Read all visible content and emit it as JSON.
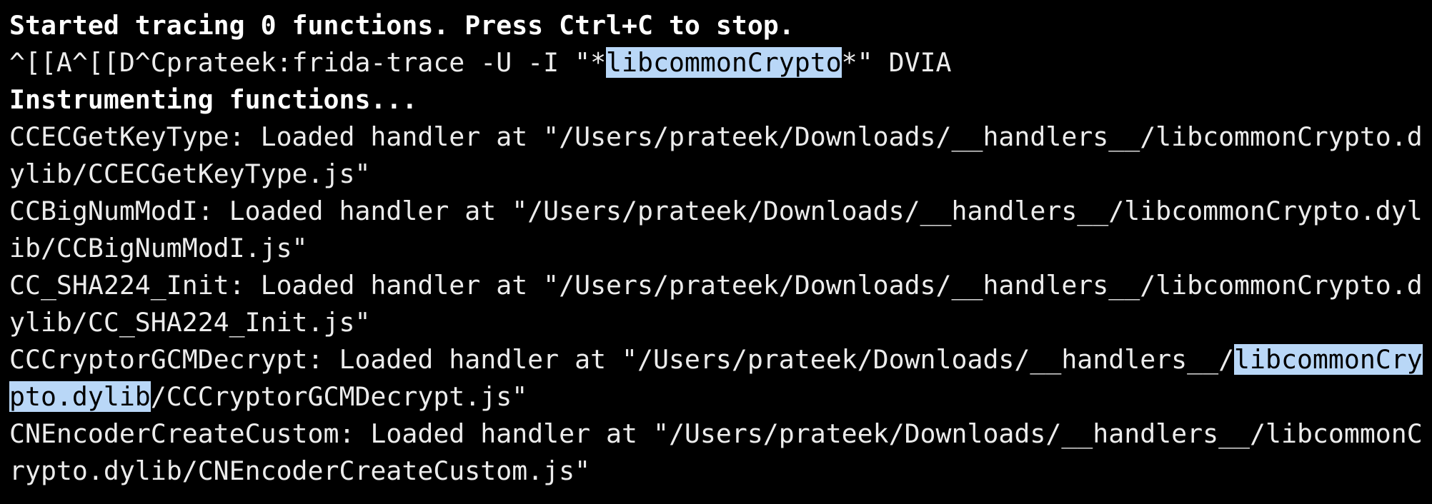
{
  "terminal": {
    "background": "#000000",
    "text_color": "#ececec",
    "selection_color": "#b9d7f7",
    "lines": {
      "l1": "Started tracing 0 functions. Press Ctrl+C to stop.",
      "l2": {
        "a": "^[[A^[[D^Cprateek:frida-trace -U -I \"*",
        "b": "libcommonCrypto",
        "c": "*\" DVIA"
      },
      "l3": "Instrumenting functions...",
      "l4": "CCECGetKeyType: Loaded handler at \"/Users/prateek/Downloads/__handlers__/libcommonCrypto.d",
      "l5": "ylib/CCECGetKeyType.js\"",
      "l6": "CCBigNumModI: Loaded handler at \"/Users/prateek/Downloads/__handlers__/libcommonCrypto.dyl",
      "l7": "ib/CCBigNumModI.js\"",
      "l8": "CC_SHA224_Init: Loaded handler at \"/Users/prateek/Downloads/__handlers__/libcommonCrypto.d",
      "l9": "ylib/CC_SHA224_Init.js\"",
      "l10": {
        "a": "CCCryptorGCMDecrypt: Loaded handler at \"/Users/prateek/Downloads/__handlers__/",
        "b": "libcommonCry"
      },
      "l11": {
        "a": "pto.dylib",
        "b": "/CCCryptorGCMDecrypt.js\""
      },
      "l12": "CNEncoderCreateCustom: Loaded handler at \"/Users/prateek/Downloads/__handlers__/libcommonC",
      "l13": "rypto.dylib/CNEncoderCreateCustom.js\""
    }
  }
}
